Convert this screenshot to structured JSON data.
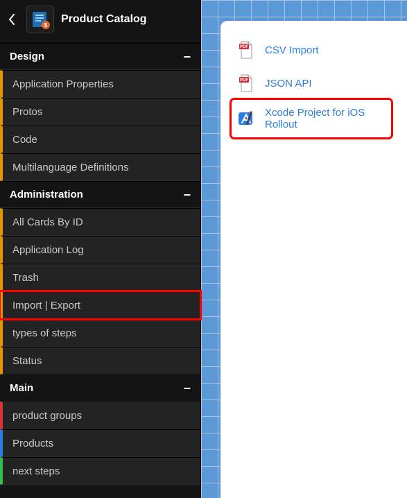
{
  "app": {
    "title": "Product Catalog",
    "icon": "catalog-icon"
  },
  "sidebar": {
    "sections": [
      {
        "label": "Design",
        "items": [
          {
            "label": "Application Properties",
            "accent": "orange"
          },
          {
            "label": "Protos",
            "accent": "orange"
          },
          {
            "label": "Code",
            "accent": "orange"
          },
          {
            "label": "Multilanguage Definitions",
            "accent": "orange"
          }
        ]
      },
      {
        "label": "Administration",
        "items": [
          {
            "label": "All Cards By ID",
            "accent": "orange"
          },
          {
            "label": "Application Log",
            "accent": "orange"
          },
          {
            "label": "Trash",
            "accent": "orange"
          },
          {
            "label": "Import | Export",
            "accent": "orange",
            "highlighted": true
          },
          {
            "label": "types of steps",
            "accent": "orange"
          },
          {
            "label": "Status",
            "accent": "orange"
          }
        ]
      },
      {
        "label": "Main",
        "items": [
          {
            "label": "product groups",
            "accent": "red"
          },
          {
            "label": "Products",
            "accent": "blue"
          },
          {
            "label": "next steps",
            "accent": "green"
          }
        ]
      }
    ]
  },
  "main": {
    "options": [
      {
        "label": "CSV Import",
        "icon": "pdf-icon"
      },
      {
        "label": "JSON API",
        "icon": "pdf-icon"
      },
      {
        "label": "Xcode Project for iOS Rollout",
        "icon": "xcode-icon",
        "highlighted": true
      }
    ]
  }
}
